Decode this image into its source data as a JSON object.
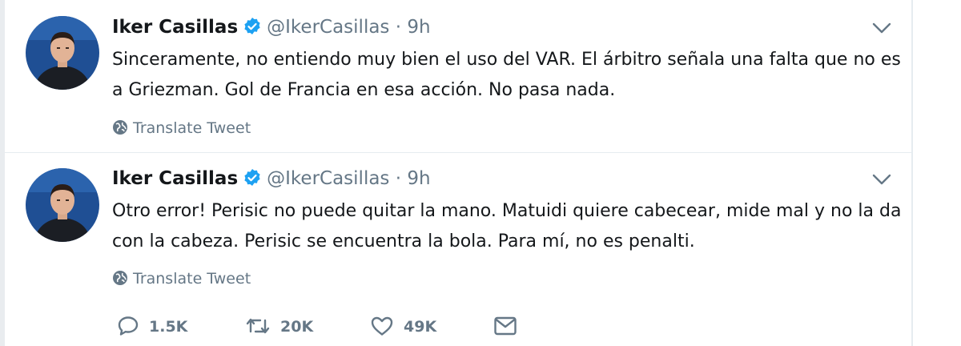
{
  "colors": {
    "text": "#14171a",
    "muted": "#657786",
    "verified": "#1da1f2",
    "divider": "#e6ecf0"
  },
  "tweets": [
    {
      "author": {
        "name": "Iker Casillas",
        "handle": "@IkerCasillas",
        "verified": true
      },
      "separator": "·",
      "time": "9h",
      "text": "Sinceramente, no entiendo muy bien el uso del VAR. El árbitro señala una falta que no es a Griezman. Gol de Francia en esa acción. No pasa nada.",
      "translate_label": "Translate Tweet"
    },
    {
      "author": {
        "name": "Iker Casillas",
        "handle": "@IkerCasillas",
        "verified": true
      },
      "separator": "·",
      "time": "9h",
      "text": "Otro error! Perisic no puede quitar la mano. Matuidi quiere cabecear, mide mal y no la da con la cabeza. Perisic se encuentra la bola. Para mí, no es penalti.",
      "translate_label": "Translate Tweet",
      "actions": {
        "replies": "1.5K",
        "retweets": "20K",
        "likes": "49K"
      }
    }
  ],
  "icons": [
    "verified-badge-icon",
    "chevron-down-icon",
    "globe-icon",
    "reply-icon",
    "retweet-icon",
    "like-icon",
    "message-icon"
  ]
}
